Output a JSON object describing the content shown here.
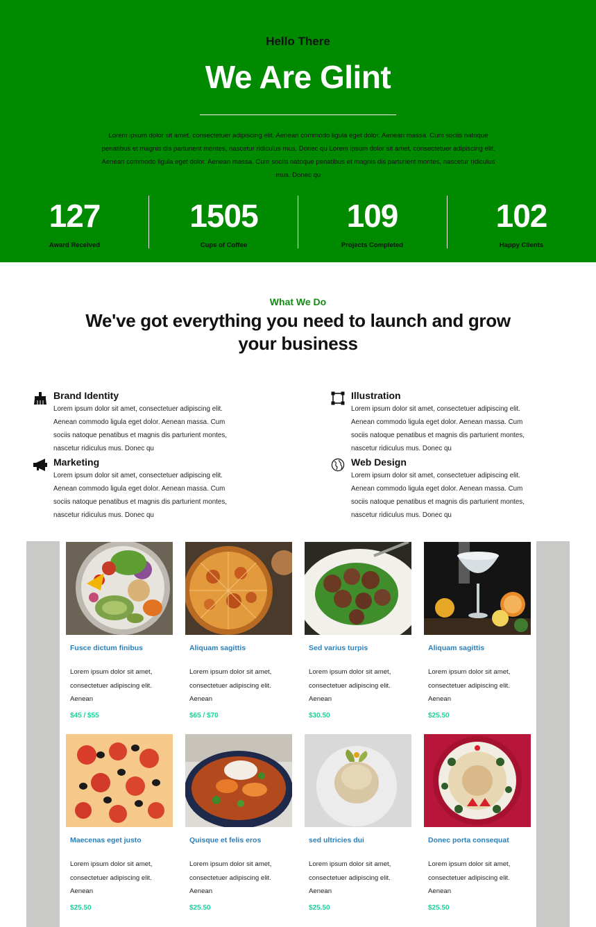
{
  "hero": {
    "kicker": "Hello There",
    "title": "We Are Glint",
    "text": "Lorem ipsum dolor sit amet, consectetuer adipiscing elit. Aenean commodo ligula eget dolor. Aenean massa. Cum sociis natoque penatibus et magnis dis parturient montes, nascetur ridiculus mus. Donec qu Lorem ipsum dolor sit amet, consectetuer adipiscing elit. Aenean commodo ligula eget dolor. Aenean massa. Cum sociis natoque penatibus et magnis dis parturient montes, nascetur ridiculus mus. Donec qu",
    "stats": [
      {
        "value": "127",
        "label": "Award Received"
      },
      {
        "value": "1505",
        "label": "Cups of Coffee"
      },
      {
        "value": "109",
        "label": "Projects Completed"
      },
      {
        "value": "102",
        "label": "Happy Clients"
      }
    ]
  },
  "services": {
    "kicker": "What We Do",
    "title": "We've got everything you need to launch and grow your business",
    "items": [
      {
        "name": "Brand Identity",
        "icon": "broom-icon",
        "description": "Lorem ipsum dolor sit amet, consectetuer adipiscing elit. Aenean commodo ligula eget dolor. Aenean massa. Cum sociis natoque penatibus et magnis dis parturient montes, nascetur ridiculus mus. Donec qu"
      },
      {
        "name": "Illustration",
        "icon": "vector-square-icon",
        "description": "Lorem ipsum dolor sit amet, consectetuer adipiscing elit. Aenean commodo ligula eget dolor. Aenean massa. Cum sociis natoque penatibus et magnis dis parturient montes, nascetur ridiculus mus. Donec qu"
      },
      {
        "name": "Marketing",
        "icon": "megaphone-icon",
        "description": "Lorem ipsum dolor sit amet, consectetuer adipiscing elit. Aenean commodo ligula eget dolor. Aenean massa. Cum sociis natoque penatibus et magnis dis parturient montes, nascetur ridiculus mus. Donec qu"
      },
      {
        "name": "Web Design",
        "icon": "globe-icon",
        "description": "Lorem ipsum dolor sit amet, consectetuer adipiscing elit. Aenean commodo ligula eget dolor. Aenean massa. Cum sociis natoque penatibus et magnis dis parturient montes, nascetur ridiculus mus. Donec qu"
      }
    ]
  },
  "menu": {
    "items": [
      {
        "title": "Fusce dictum finibus",
        "description": "Lorem ipsum dolor sit amet, consectetuer adipiscing elit. Aenean",
        "price": "$45 / $55",
        "image": "salad-bowl-photo"
      },
      {
        "title": "Aliquam sagittis",
        "description": "Lorem ipsum dolor sit amet, consectetuer adipiscing elit. Aenean",
        "price": "$65 / $70",
        "image": "pizza-photo"
      },
      {
        "title": "Sed varius turpis",
        "description": "Lorem ipsum dolor sit amet, consectetuer adipiscing elit. Aenean",
        "price": "$30.50",
        "image": "meatballs-photo"
      },
      {
        "title": "Aliquam sagittis",
        "description": "Lorem ipsum dolor sit amet, consectetuer adipiscing elit. Aenean",
        "price": "$25.50",
        "image": "cocktail-photo"
      },
      {
        "title": "Maecenas eget justo",
        "description": "Lorem ipsum dolor sit amet, consectetuer adipiscing elit. Aenean",
        "price": "$25.50",
        "image": "pepperoni-pizza-photo"
      },
      {
        "title": "Quisque et felis eros",
        "description": "Lorem ipsum dolor sit amet, consectetuer adipiscing elit. Aenean",
        "price": "$25.50",
        "image": "curry-bowl-photo"
      },
      {
        "title": "sed ultricies dui",
        "description": "Lorem ipsum dolor sit amet, consectetuer adipiscing elit. Aenean",
        "price": "$25.50",
        "image": "pasta-plate-photo"
      },
      {
        "title": "Donec porta consequat",
        "description": "Lorem ipsum dolor sit amet, consectetuer adipiscing elit. Aenean",
        "price": "$25.50",
        "image": "tart-plate-photo"
      }
    ]
  },
  "colors": {
    "hero_bg": "#008a00",
    "accent_green": "#138a13",
    "link_blue": "#2b7fb8",
    "price_green": "#16d39a",
    "menu_bg": "#c9c9c7"
  }
}
